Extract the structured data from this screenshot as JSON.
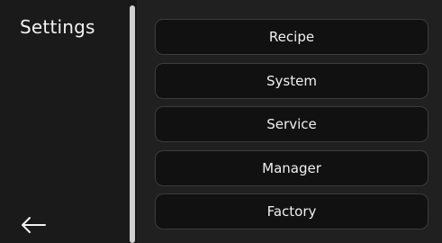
{
  "header": {
    "title": "Settings"
  },
  "navigation": {
    "back_icon": "arrow-left-icon"
  },
  "menu": {
    "items": [
      {
        "label": "Recipe"
      },
      {
        "label": "System"
      },
      {
        "label": "Service"
      },
      {
        "label": "Manager"
      },
      {
        "label": "Factory"
      }
    ]
  },
  "colors": {
    "background": "#161616",
    "button_fill": "#111111",
    "button_border": "#3c3c3c",
    "text": "#f0f0f0",
    "divider": "#cfcfcf"
  }
}
